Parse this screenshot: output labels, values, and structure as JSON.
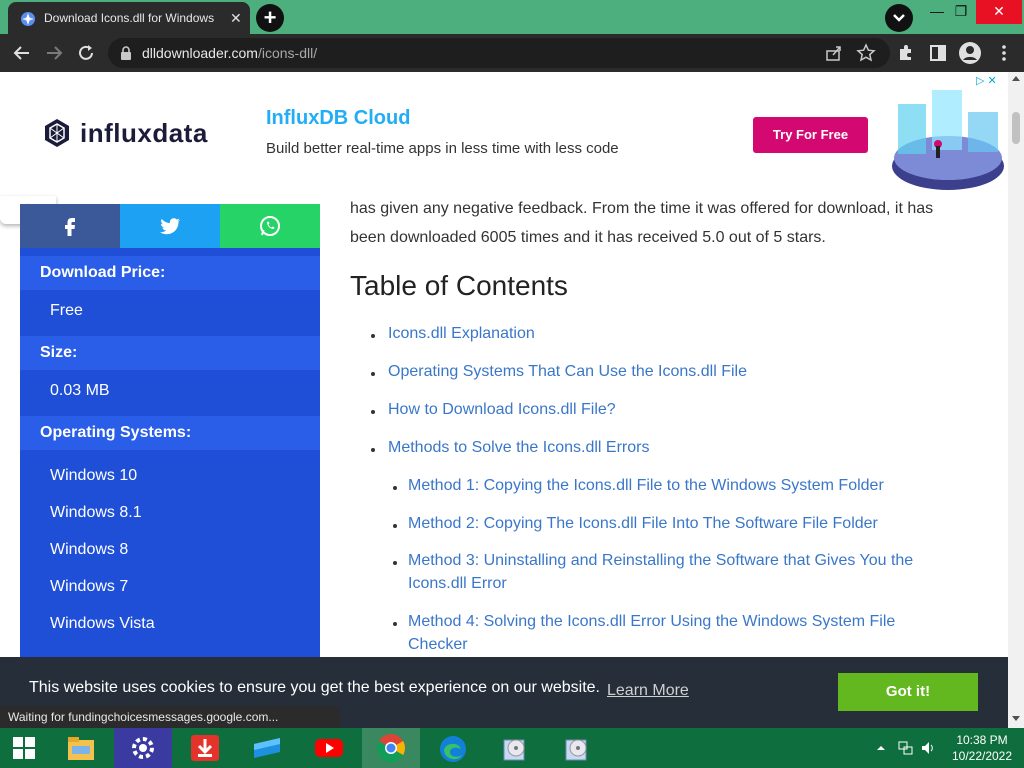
{
  "browser": {
    "tab_title": "Download Icons.dll for Windows",
    "url_domain": "dlldownloader.com",
    "url_path": "/icons-dll/",
    "status_text": "Waiting for fundingchoicesmessages.google.com..."
  },
  "ad": {
    "brand": "influxdata",
    "headline": "InfluxDB Cloud",
    "tagline": "Build better real-time apps in less time with less code",
    "cta": "Try For Free",
    "brand_color": "#d30971",
    "headline_color": "#22adf6"
  },
  "sidebar": {
    "share": [
      "facebook-icon",
      "twitter-icon",
      "whatsapp-icon"
    ],
    "download_price_label": "Download Price:",
    "download_price_value": "Free",
    "size_label": "Size:",
    "size_value": "0.03 MB",
    "os_label": "Operating Systems:",
    "os_items": [
      "Windows 10",
      "Windows 8.1",
      "Windows 8",
      "Windows 7",
      "Windows Vista"
    ],
    "bg_color": "#1e4fd6"
  },
  "article": {
    "para_line1": "has given any negative feedback. From the time it was offered for download, it has",
    "para_line2": "been downloaded 6005 times and it has received 5.0 out of 5 stars.",
    "toc_title": "Table of Contents",
    "toc": [
      "Icons.dll Explanation",
      "Operating Systems That Can Use the Icons.dll File",
      "How to Download Icons.dll File?",
      "Methods to Solve the Icons.dll Errors"
    ],
    "methods": [
      "Method 1: Copying the Icons.dll File to the Windows System Folder",
      "Method 2: Copying The Icons.dll File Into The Software File Folder",
      "Method 3: Uninstalling and Reinstalling the Software that Gives You the",
      "Icons.dll Error",
      "Method 4: Solving the Icons.dll Error Using the Windows System File",
      "Checker"
    ],
    "link_color": "#3a77c9"
  },
  "cookie": {
    "message": "This website uses cookies to ensure you get the best experience on our website.",
    "learn_more": "Learn More",
    "button": "Got it!",
    "button_color": "#63b81f"
  },
  "taskbar": {
    "apps": [
      "windows-start-icon",
      "file-explorer-icon",
      "settings-app-icon",
      "download-manager-icon",
      "tablet-app-icon",
      "youtube-icon",
      "chrome-icon",
      "edge-icon",
      "installer-icon",
      "installer-icon"
    ],
    "time": "10:38 PM",
    "date": "10/22/2022",
    "accent": "#0f6e3e"
  }
}
